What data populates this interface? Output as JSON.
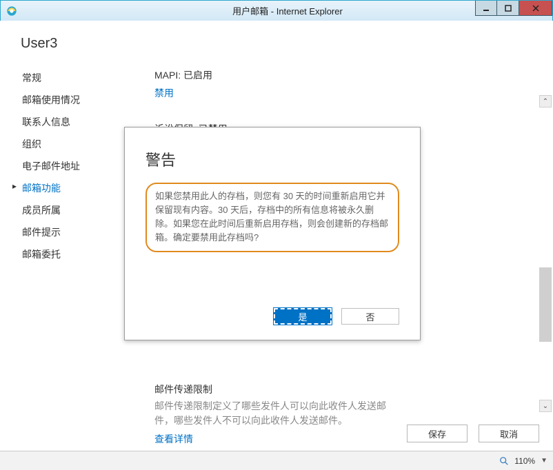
{
  "window": {
    "title": "用户邮箱 - Internet Explorer"
  },
  "user": {
    "name": "User3"
  },
  "sidebar": {
    "items": [
      {
        "label": "常规"
      },
      {
        "label": "邮箱使用情况"
      },
      {
        "label": "联系人信息"
      },
      {
        "label": "组织"
      },
      {
        "label": "电子邮件地址"
      },
      {
        "label": "邮箱功能"
      },
      {
        "label": "成员所属"
      },
      {
        "label": "邮件提示"
      },
      {
        "label": "邮箱委托"
      }
    ],
    "selected_index": 5
  },
  "main": {
    "mapi_label": "MAPI: 已启用",
    "mapi_disable": "禁用",
    "hold_label": "诉讼保留: 已禁用",
    "delivery": {
      "title": "邮件传递限制",
      "body": "邮件传递限制定义了哪些发件人可以向此收件人发送邮件，哪些发件人不可以向此收件人发送邮件。",
      "link": "查看详情"
    }
  },
  "dialog": {
    "title": "警告",
    "body": "如果您禁用此人的存档，则您有 30 天的时间重新启用它并保留现有内容。30 天后，存档中的所有信息将被永久删除。如果您在此时间后重新启用存档，则会创建新的存档邮箱。确定要禁用此存档吗?",
    "yes": "是",
    "no": "否"
  },
  "footer": {
    "save": "保存",
    "cancel": "取消"
  },
  "status": {
    "zoom": "110%"
  }
}
